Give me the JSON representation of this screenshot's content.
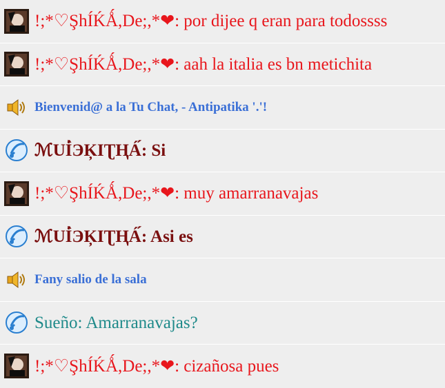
{
  "colors": {
    "red": "#e8161c",
    "dark_red": "#7a0f0f",
    "teal": "#1f8a8a",
    "system_blue": "#3a6fd6",
    "row_bg": "#eeeeee"
  },
  "messages": [
    {
      "icon": "avatar-photo-icon",
      "text": "!;*♡ŞhÍḰǺ,De;,*❤: por dijee q eran para todossss"
    },
    {
      "icon": "avatar-photo-icon",
      "text": "!;*♡ŞhÍḰǺ,De;,*❤: aah la italia es bn metichita"
    },
    {
      "icon": "speaker-icon",
      "text": "Bienvenid@ a la Tu Chat, - Antipatika '.'!"
    },
    {
      "icon": "note-icon",
      "text": "ℳUİ̀ЭĶIƮҢÁ́: Si"
    },
    {
      "icon": "avatar-photo-icon",
      "text": "!;*♡ŞhÍḰǺ,De;,*❤: muy amarranavajas"
    },
    {
      "icon": "note-icon",
      "text": "ℳUİ̀ЭĶIƮҢÁ́: Asi es"
    },
    {
      "icon": "speaker-icon",
      "text": "Fany salio de la sala"
    },
    {
      "icon": "note-icon",
      "text": "Sueño: Amarranavajas?"
    },
    {
      "icon": "avatar-photo-icon",
      "text": "!;*♡ŞhÍḰǺ,De;,*❤: cizañosa pues"
    }
  ]
}
